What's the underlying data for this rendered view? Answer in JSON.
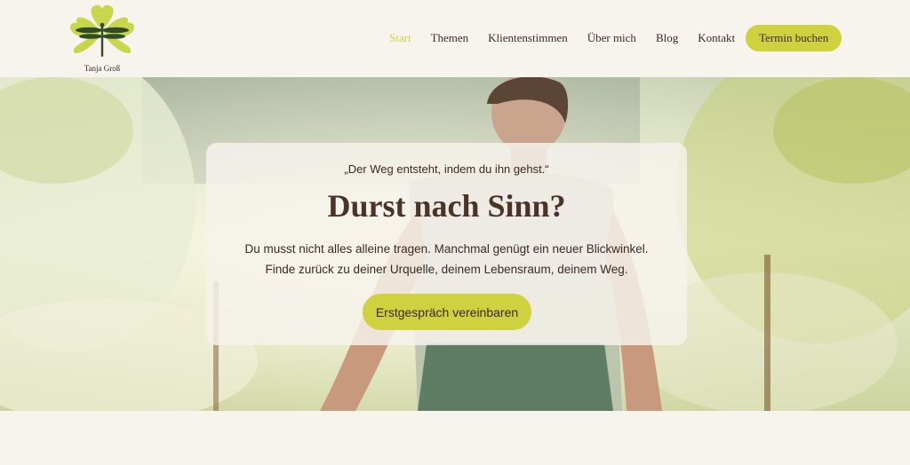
{
  "brand": {
    "name": "Tanja Groß",
    "accent": "#cfd13f",
    "text": "#3b2a23",
    "background": "#f7f4ee"
  },
  "nav": {
    "items": [
      {
        "label": "Start",
        "active": true
      },
      {
        "label": "Themen"
      },
      {
        "label": "Klientenstimmen"
      },
      {
        "label": "Über mich"
      },
      {
        "label": "Blog"
      },
      {
        "label": "Kontakt"
      }
    ],
    "cta": "Termin buchen"
  },
  "hero": {
    "quote": "„Der Weg entsteht, indem du ihn gehst.“",
    "headline": "Durst nach Sinn?",
    "body_line1": "Du musst nicht alles alleine tragen. Manchmal genügt ein neuer Blickwinkel.",
    "body_line2": "Finde zurück zu deiner Urquelle, deinem Lebensraum, deinem Weg.",
    "button": "Erstgespräch vereinbaren"
  }
}
